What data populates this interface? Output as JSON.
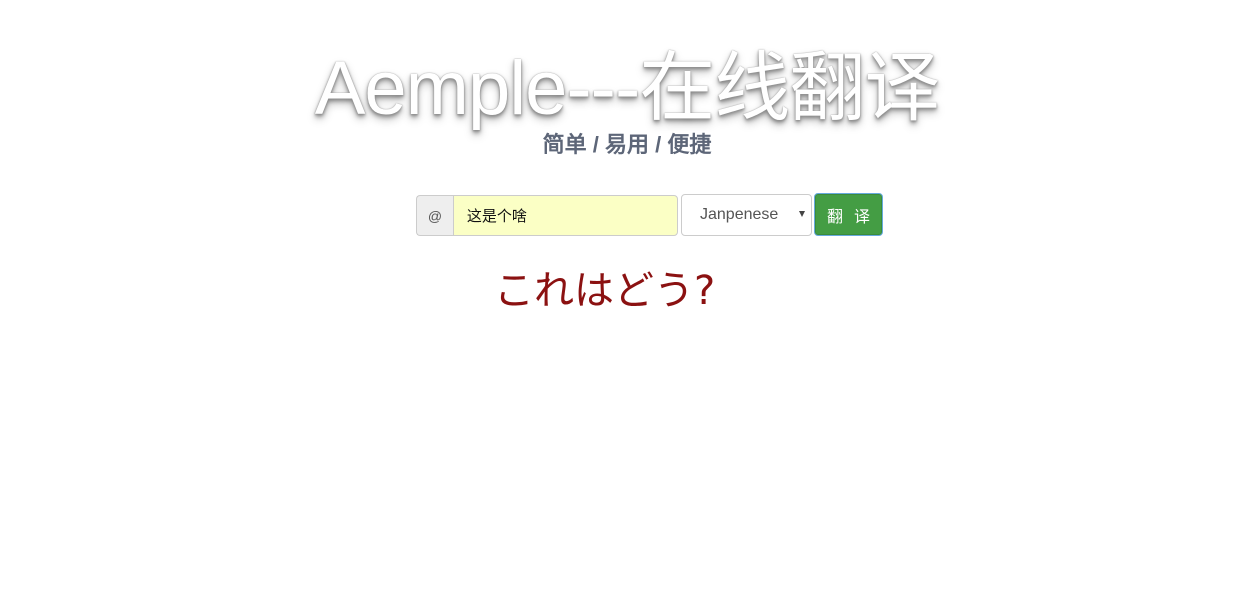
{
  "header": {
    "title": "Aemple---在线翻译",
    "subtitle": "简单 / 易用 / 便捷"
  },
  "form": {
    "addon_symbol": "@",
    "input_value": "这是个啥",
    "selected_language": "Janpenese",
    "translate_button_label": "翻 译"
  },
  "result": {
    "text": "これはどう?"
  },
  "colors": {
    "input_background": "#fbffc5",
    "button_background": "#449d44",
    "result_text": "#8b1111",
    "subtitle_text": "#5d6678"
  }
}
